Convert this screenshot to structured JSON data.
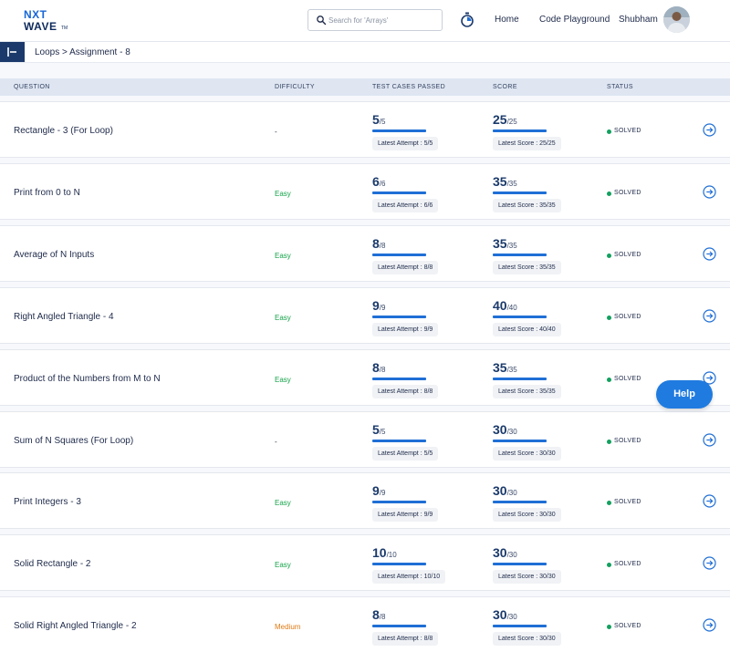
{
  "header": {
    "logo_top": "NXT",
    "logo_bottom": "WAVE",
    "logo_tm": "TM",
    "search_placeholder": "Search for 'Arrays'",
    "nav_home": "Home",
    "nav_playground": "Code Playground",
    "user_name": "Shubham"
  },
  "breadcrumb": "Loops > Assignment - 8",
  "columns": {
    "question": "QUESTION",
    "difficulty": "DIFFICULTY",
    "test_cases": "TEST CASES PASSED",
    "score": "SCORE",
    "status": "STATUS"
  },
  "colors": {
    "easy": "#16a34a",
    "medium": "#e07b13",
    "none": "#1e2a4a",
    "accent": "#1f6fd6"
  },
  "rows": [
    {
      "name": "Rectangle - 3 (For Loop)",
      "difficulty": "-",
      "diff_level": "none",
      "tc": "5",
      "tc_total": "/5",
      "tc_chip": "Latest Attempt : 5/5",
      "score": "25",
      "score_total": "/25",
      "score_chip": "Latest Score : 25/25",
      "status": "SOLVED"
    },
    {
      "name": "Print from 0 to N",
      "difficulty": "Easy",
      "diff_level": "easy",
      "tc": "6",
      "tc_total": "/6",
      "tc_chip": "Latest Attempt : 6/6",
      "score": "35",
      "score_total": "/35",
      "score_chip": "Latest Score : 35/35",
      "status": "SOLVED"
    },
    {
      "name": "Average of N Inputs",
      "difficulty": "Easy",
      "diff_level": "easy",
      "tc": "8",
      "tc_total": "/8",
      "tc_chip": "Latest Attempt : 8/8",
      "score": "35",
      "score_total": "/35",
      "score_chip": "Latest Score : 35/35",
      "status": "SOLVED"
    },
    {
      "name": "Right Angled Triangle - 4",
      "difficulty": "Easy",
      "diff_level": "easy",
      "tc": "9",
      "tc_total": "/9",
      "tc_chip": "Latest Attempt : 9/9",
      "score": "40",
      "score_total": "/40",
      "score_chip": "Latest Score : 40/40",
      "status": "SOLVED"
    },
    {
      "name": "Product of the Numbers from M to N",
      "difficulty": "Easy",
      "diff_level": "easy",
      "tc": "8",
      "tc_total": "/8",
      "tc_chip": "Latest Attempt : 8/8",
      "score": "35",
      "score_total": "/35",
      "score_chip": "Latest Score : 35/35",
      "status": "SOLVED"
    },
    {
      "name": "Sum of N Squares (For Loop)",
      "difficulty": "-",
      "diff_level": "none",
      "tc": "5",
      "tc_total": "/5",
      "tc_chip": "Latest Attempt : 5/5",
      "score": "30",
      "score_total": "/30",
      "score_chip": "Latest Score : 30/30",
      "status": "SOLVED"
    },
    {
      "name": "Print Integers - 3",
      "difficulty": "Easy",
      "diff_level": "easy",
      "tc": "9",
      "tc_total": "/9",
      "tc_chip": "Latest Attempt : 9/9",
      "score": "30",
      "score_total": "/30",
      "score_chip": "Latest Score : 30/30",
      "status": "SOLVED"
    },
    {
      "name": "Solid Rectangle - 2",
      "difficulty": "Easy",
      "diff_level": "easy",
      "tc": "10",
      "tc_total": "/10",
      "tc_chip": "Latest Attempt : 10/10",
      "score": "30",
      "score_total": "/30",
      "score_chip": "Latest Score : 30/30",
      "status": "SOLVED"
    },
    {
      "name": "Solid Right Angled Triangle - 2",
      "difficulty": "Medium",
      "diff_level": "medium",
      "tc": "8",
      "tc_total": "/8",
      "tc_chip": "Latest Attempt : 8/8",
      "score": "30",
      "score_total": "/30",
      "score_chip": "Latest Score : 30/30",
      "status": "SOLVED"
    }
  ],
  "help_label": "Help"
}
